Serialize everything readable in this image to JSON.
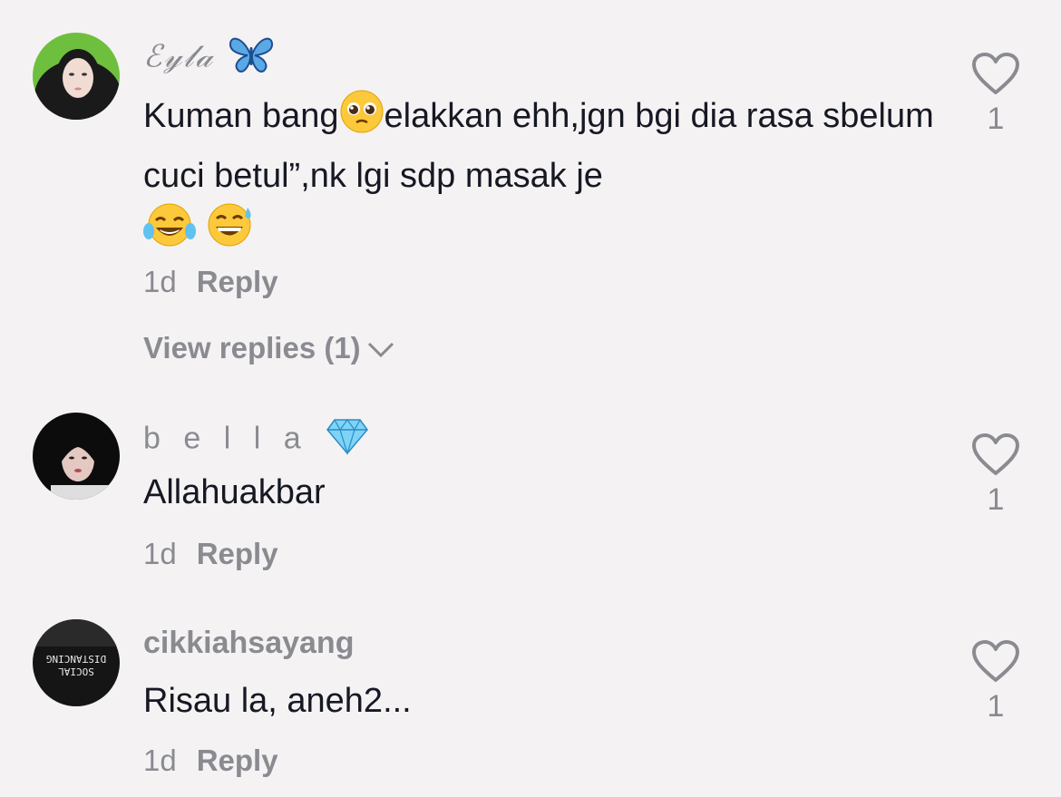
{
  "comments": [
    {
      "username": "ℰ𝓎𝓁𝒶",
      "username_emoji": "butterfly-icon",
      "text_parts": [
        "Kuman bang",
        "elakkan ehh,jgn bgi dia rasa sbelum cuci betul”,nk lgi sdp masak je"
      ],
      "emojis": [
        "pleading-face-icon",
        "tears-of-joy-icon",
        "grinning-sweat-icon"
      ],
      "time": "1d",
      "reply_label": "Reply",
      "view_replies": "View replies (1)",
      "likes": "1"
    },
    {
      "username": "b e l l a",
      "username_emoji": "gem-icon",
      "text": "Allahuakbar",
      "time": "1d",
      "reply_label": "Reply",
      "likes": "1"
    },
    {
      "username": "cikkiahsayang",
      "text": "Risau la, aneh2...",
      "avatar_text": [
        "SOCIAL",
        "DISTANCING"
      ],
      "time": "1d",
      "reply_label": "Reply",
      "likes": "1"
    }
  ],
  "colors": {
    "background": "#f5f2f3",
    "primary_text": "#161823",
    "secondary_text": "#8a8b91"
  }
}
